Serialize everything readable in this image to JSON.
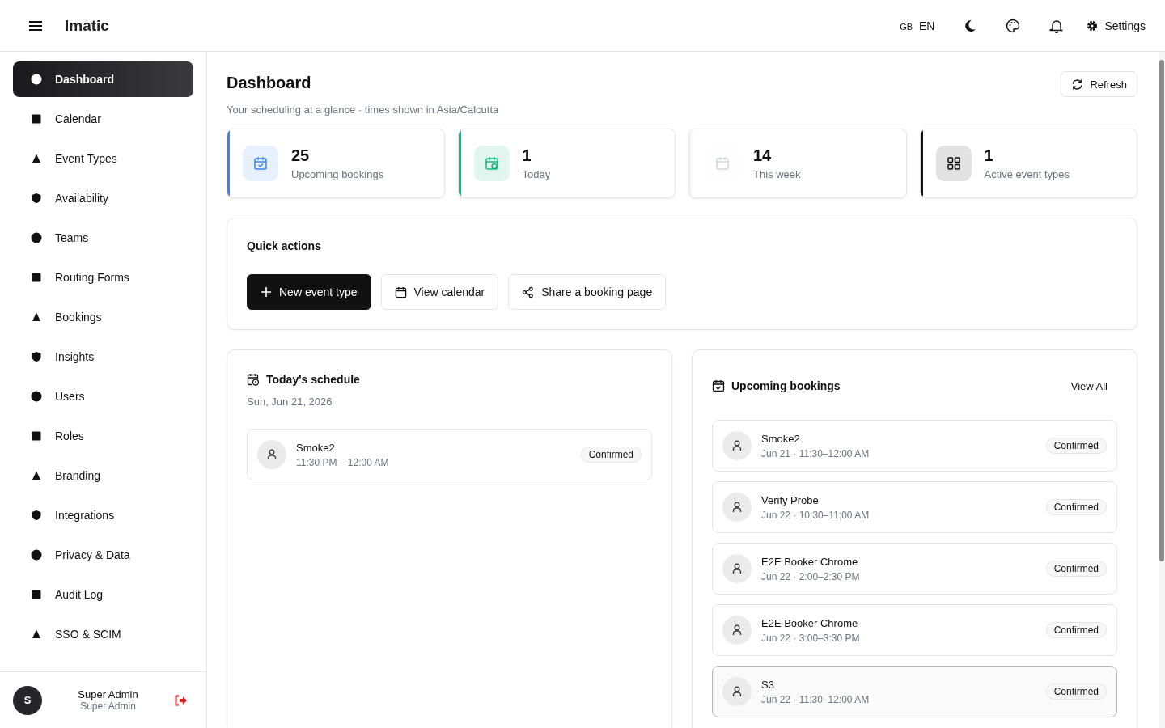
{
  "header": {
    "brand": "Imatic",
    "locale_flag": "GB",
    "locale": "EN",
    "settings": "Settings"
  },
  "sidebar": {
    "items": [
      {
        "label": "Dashboard",
        "selected": true
      },
      {
        "label": "Calendar",
        "selected": false
      },
      {
        "label": "Event Types",
        "selected": false
      },
      {
        "label": "Availability",
        "selected": false
      },
      {
        "label": "Teams",
        "selected": false
      },
      {
        "label": "Routing Forms",
        "selected": false
      },
      {
        "label": "Bookings",
        "selected": false
      },
      {
        "label": "Insights",
        "selected": false
      },
      {
        "label": "Users",
        "selected": false
      },
      {
        "label": "Roles",
        "selected": false
      },
      {
        "label": "Branding",
        "selected": false
      },
      {
        "label": "Integrations",
        "selected": false
      },
      {
        "label": "Privacy & Data",
        "selected": false
      },
      {
        "label": "Audit Log",
        "selected": false
      },
      {
        "label": "SSO & SCIM",
        "selected": false
      }
    ],
    "user": {
      "initial": "S",
      "name": "Super Admin",
      "role": "Super Admin"
    }
  },
  "page": {
    "title": "Dashboard",
    "subtitle": "Your scheduling at a glance · times shown in Asia/Calcutta",
    "refresh": "Refresh"
  },
  "stats": [
    {
      "value": "25",
      "label": "Upcoming bookings",
      "color": "#3b82f6"
    },
    {
      "value": "1",
      "label": "Today",
      "color": "#10b981"
    },
    {
      "value": "14",
      "label": "This week",
      "color": "#f3f4f6"
    },
    {
      "value": "1",
      "label": "Active event types",
      "color": "#111111"
    }
  ],
  "quick_actions": {
    "title": "Quick actions",
    "buttons": [
      {
        "label": "New event type",
        "kind": "primary"
      },
      {
        "label": "View calendar",
        "kind": "outline"
      },
      {
        "label": "Share a booking page",
        "kind": "outline"
      }
    ]
  },
  "today": {
    "title": "Today's schedule",
    "date": "Sun, Jun 21, 2026",
    "items": [
      {
        "name": "Smoke2",
        "time": "11:30 PM – 12:00 AM",
        "status": "Confirmed"
      }
    ]
  },
  "upcoming": {
    "title": "Upcoming bookings",
    "view_all": "View All",
    "items": [
      {
        "name": "Smoke2",
        "time": "Jun 21 · 11:30–12:00 AM",
        "status": "Confirmed",
        "highlighted": false
      },
      {
        "name": "Verify Probe",
        "time": "Jun 22 · 10:30–11:00 AM",
        "status": "Confirmed",
        "highlighted": false
      },
      {
        "name": "E2E Booker Chrome",
        "time": "Jun 22 · 2:00–2:30 PM",
        "status": "Confirmed",
        "highlighted": false
      },
      {
        "name": "E2E Booker Chrome",
        "time": "Jun 22 · 3:00–3:30 PM",
        "status": "Confirmed",
        "highlighted": false
      },
      {
        "name": "S3",
        "time": "Jun 22 · 11:30–12:00 AM",
        "status": "Confirmed",
        "highlighted": true
      }
    ]
  }
}
